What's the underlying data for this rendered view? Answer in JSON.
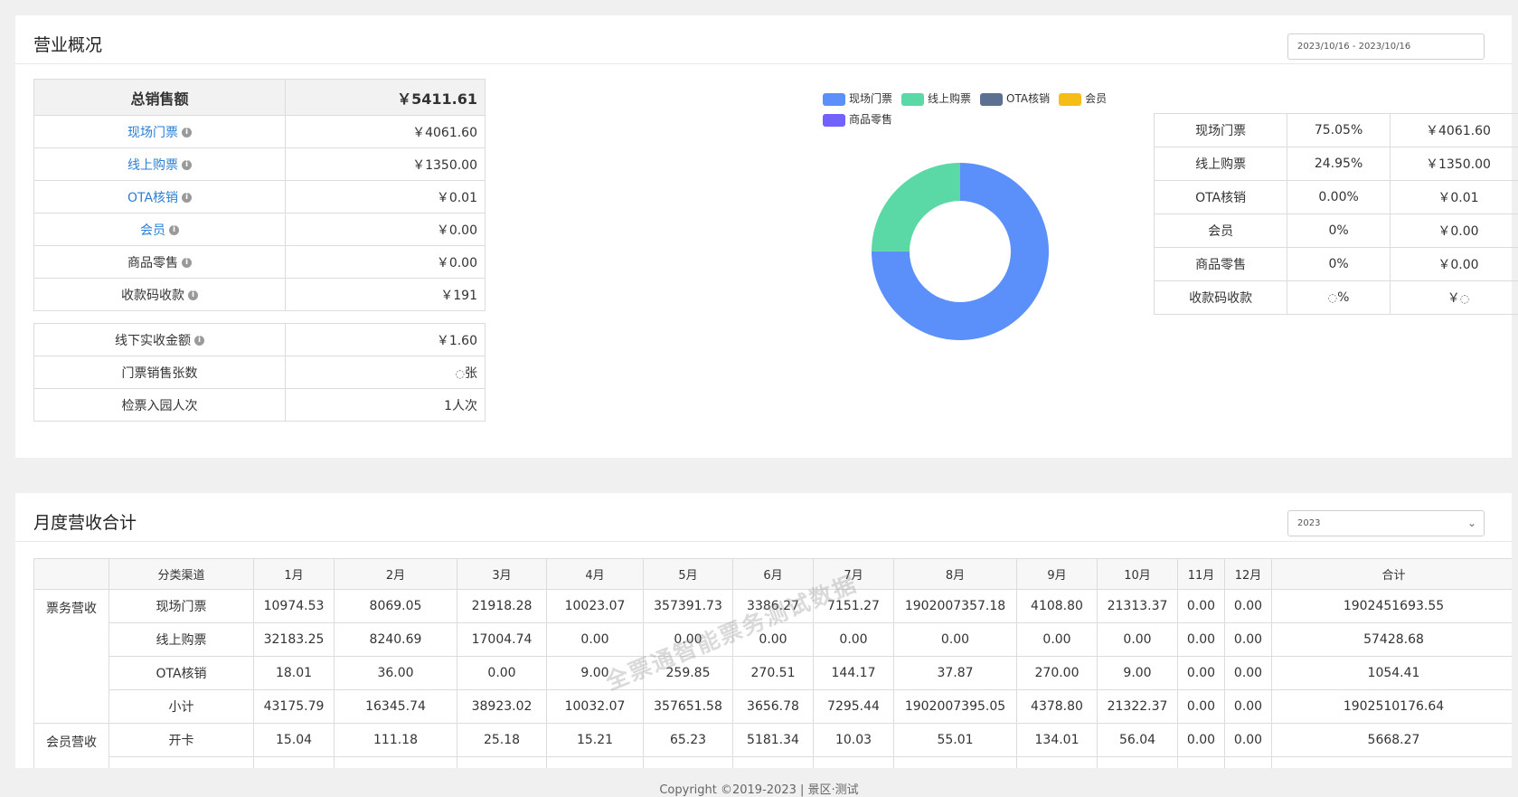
{
  "overview": {
    "title": "营业概况",
    "date_range": "2023/10/16 - 2023/10/16",
    "summary_header": {
      "label": "总销售额",
      "value": "￥5411.61"
    },
    "summary_rows": [
      {
        "label": "现场门票",
        "value": "￥4061.60",
        "link": true,
        "info": true
      },
      {
        "label": "线上购票",
        "value": "￥1350.00",
        "link": true,
        "info": true
      },
      {
        "label": "OTA核销",
        "value": "￥0.01",
        "link": true,
        "info": true
      },
      {
        "label": "会员",
        "value": "￥0.00",
        "link": true,
        "info": true
      },
      {
        "label": "商品零售",
        "value": "￥0.00",
        "link": false,
        "info": true
      },
      {
        "label": "收款码收款",
        "value": "￥191",
        "link": false,
        "info": true
      }
    ],
    "summary2_rows": [
      {
        "label": "线下实收金额",
        "value": "￥1.60",
        "info": true
      },
      {
        "label": "门票销售张数",
        "value": "张",
        "info": false
      },
      {
        "label": "检票入园人次",
        "value": "1人次",
        "info": false
      }
    ],
    "legend": [
      {
        "name": "现场门票",
        "color": "#5b8ff9"
      },
      {
        "name": "线上购票",
        "color": "#5ad8a6"
      },
      {
        "name": "OTA核销",
        "color": "#5d7092"
      },
      {
        "name": "会员",
        "color": "#f6bd16"
      },
      {
        "name": "商品零售",
        "color": "#7262fd"
      }
    ],
    "share_rows": [
      {
        "name": "现场门票",
        "pct": "75.05%",
        "amount": "￥4061.60"
      },
      {
        "name": "线上购票",
        "pct": "24.95%",
        "amount": "￥1350.00"
      },
      {
        "name": "OTA核销",
        "pct": "0.00%",
        "amount": "￥0.01"
      },
      {
        "name": "会员",
        "pct": "0%",
        "amount": "￥0.00"
      },
      {
        "name": "商品零售",
        "pct": "0%",
        "amount": "￥0.00"
      },
      {
        "name": "收款码收款",
        "pct": "%",
        "amount": "￥"
      }
    ]
  },
  "chart_data": {
    "type": "pie",
    "categories": [
      "现场门票",
      "线上购票",
      "OTA核销",
      "会员",
      "商品零售"
    ],
    "values": [
      75.05,
      24.95,
      0.0,
      0,
      0
    ],
    "legend_position": "top"
  },
  "monthly": {
    "title": "月度营收合计",
    "year": "2023",
    "headers": [
      "",
      "分类渠道",
      "1月",
      "2月",
      "3月",
      "4月",
      "5月",
      "6月",
      "7月",
      "8月",
      "9月",
      "10月",
      "11月",
      "12月",
      "合计"
    ],
    "groups": [
      {
        "name": "票务营收",
        "rows": [
          [
            "现场门票",
            "10974.53",
            "8069.05",
            "21918.28",
            "10023.07",
            "357391.73",
            "3386.27",
            "7151.27",
            "1902007357.18",
            "4108.80",
            "21313.37",
            "0.00",
            "0.00",
            "1902451693.55"
          ],
          [
            "线上购票",
            "32183.25",
            "8240.69",
            "17004.74",
            "0.00",
            "0.00",
            "0.00",
            "0.00",
            "0.00",
            "0.00",
            "0.00",
            "0.00",
            "0.00",
            "57428.68"
          ],
          [
            "OTA核销",
            "18.01",
            "36.00",
            "0.00",
            "9.00",
            "259.85",
            "270.51",
            "144.17",
            "37.87",
            "270.00",
            "9.00",
            "0.00",
            "0.00",
            "1054.41"
          ],
          [
            "小计",
            "43175.79",
            "16345.74",
            "38923.02",
            "10032.07",
            "357651.58",
            "3656.78",
            "7295.44",
            "1902007395.05",
            "4378.80",
            "21322.37",
            "0.00",
            "0.00",
            "1902510176.64"
          ]
        ]
      },
      {
        "name": "会员营收",
        "rows": [
          [
            "开卡",
            "15.04",
            "111.18",
            "25.18",
            "15.21",
            "65.23",
            "5181.34",
            "10.03",
            "55.01",
            "134.01",
            "56.04",
            "0.00",
            "0.00",
            "5668.27"
          ]
        ]
      }
    ]
  },
  "watermark": "全票通智能票务测试数据",
  "footer": "Copyright ©2019-2023 | 景区·测试"
}
